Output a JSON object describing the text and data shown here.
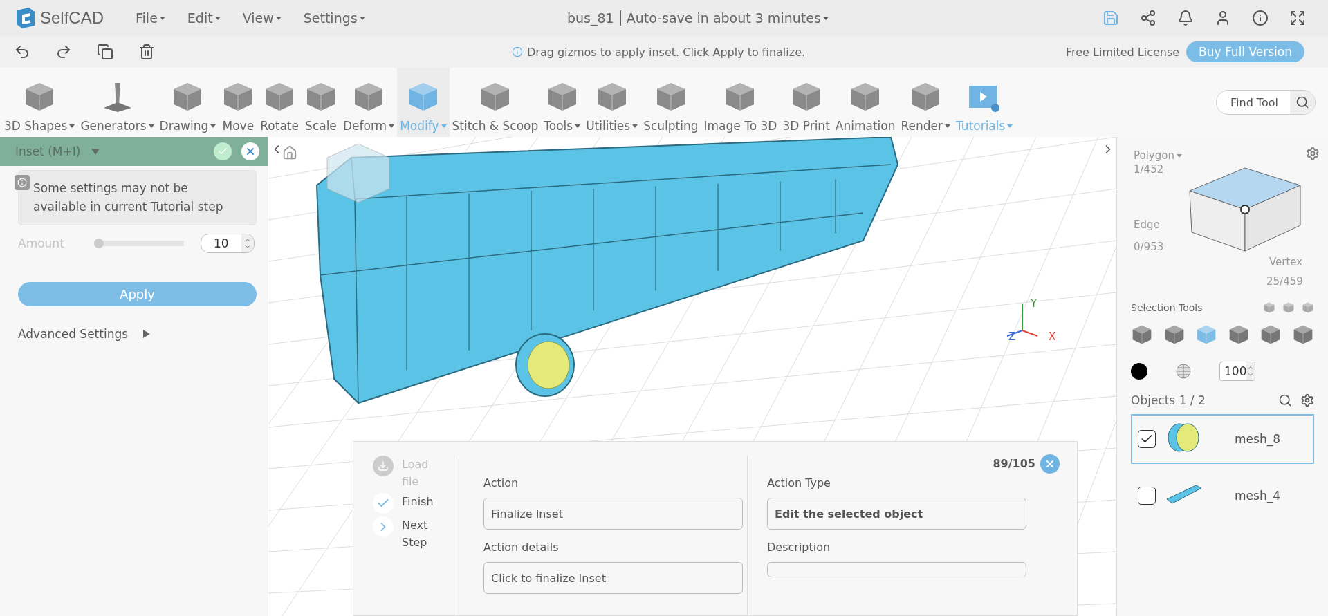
{
  "app": {
    "logo": "SelfCAD"
  },
  "menu": [
    {
      "label": "File"
    },
    {
      "label": "Edit"
    },
    {
      "label": "View"
    },
    {
      "label": "Settings"
    }
  ],
  "document": {
    "title": "bus_81",
    "autosave": "Auto-save in about 3 minutes"
  },
  "hint": "Drag gizmos to apply inset. Click Apply to finalize.",
  "license": {
    "label": "Free Limited License",
    "button": "Buy Full Version"
  },
  "toolbar": [
    {
      "label": "3D Shapes",
      "dropdown": true,
      "selected": false,
      "highlighted": false
    },
    {
      "label": "Generators",
      "dropdown": true,
      "selected": false,
      "highlighted": false
    },
    {
      "label": "Drawing",
      "dropdown": true,
      "selected": false,
      "highlighted": false
    },
    {
      "label": "Move",
      "dropdown": false,
      "selected": false,
      "highlighted": false
    },
    {
      "label": "Rotate",
      "dropdown": false,
      "selected": false,
      "highlighted": false
    },
    {
      "label": "Scale",
      "dropdown": false,
      "selected": false,
      "highlighted": false
    },
    {
      "label": "Deform",
      "dropdown": true,
      "selected": false,
      "highlighted": false
    },
    {
      "label": "Modify",
      "dropdown": true,
      "selected": true,
      "highlighted": true
    },
    {
      "label": "Stitch & Scoop",
      "dropdown": false,
      "selected": false,
      "highlighted": false
    },
    {
      "label": "Tools",
      "dropdown": true,
      "selected": false,
      "highlighted": false
    },
    {
      "label": "Utilities",
      "dropdown": true,
      "selected": false,
      "highlighted": false
    },
    {
      "label": "Sculpting",
      "dropdown": false,
      "selected": false,
      "highlighted": false
    },
    {
      "label": "Image To 3D",
      "dropdown": false,
      "selected": false,
      "highlighted": false
    },
    {
      "label": "3D Print",
      "dropdown": false,
      "selected": false,
      "highlighted": false
    },
    {
      "label": "Animation",
      "dropdown": false,
      "selected": false,
      "highlighted": false
    },
    {
      "label": "Render",
      "dropdown": true,
      "selected": false,
      "highlighted": false
    },
    {
      "label": "Tutorials",
      "dropdown": true,
      "selected": false,
      "highlighted": true
    }
  ],
  "find_tool": {
    "placeholder": "Find Tool"
  },
  "tool_panel": {
    "title": "Inset (M+I)",
    "notice": "Some settings may not be available in current Tutorial step",
    "amount": {
      "label": "Amount",
      "level": 0.0,
      "value": "10"
    },
    "apply": "Apply",
    "advanced": "Advanced Settings"
  },
  "viewport": {
    "axes": [
      {
        "label": "Y"
      },
      {
        "label": "Z"
      },
      {
        "label": "X"
      }
    ]
  },
  "tutorial": {
    "counter": "89/105",
    "steps": [
      {
        "label": "Load file",
        "kind": "load",
        "disabled": true
      },
      {
        "label": "Finish",
        "kind": "finish",
        "disabled": false
      },
      {
        "label": "Next Step",
        "kind": "next",
        "disabled": false
      }
    ],
    "action": {
      "label": "Action",
      "value": "Finalize Inset"
    },
    "action_details": {
      "label": "Action details",
      "value": "Click to finalize Inset"
    },
    "action_type": {
      "label": "Action Type",
      "value": "Edit the selected object"
    },
    "description": {
      "label": "Description"
    }
  },
  "selection": {
    "polygon": {
      "label": "Polygon",
      "count": "1/452"
    },
    "edge": {
      "label": "Edge",
      "count": "0/953"
    },
    "vertex": {
      "label": "Vertex",
      "count": "25/459"
    },
    "tools_label": "Selection Tools",
    "modes": [
      {
        "selected": false
      },
      {
        "selected": false
      },
      {
        "selected": true
      },
      {
        "selected": false
      },
      {
        "selected": false
      },
      {
        "selected": false
      }
    ],
    "opacity": "100"
  },
  "objects": {
    "title": "Objects 1 / 2",
    "items": [
      {
        "name": "mesh_8",
        "checked": true,
        "selected": true,
        "kind": "wheel"
      },
      {
        "name": "mesh_4",
        "checked": false,
        "selected": false,
        "kind": "bus"
      }
    ]
  }
}
